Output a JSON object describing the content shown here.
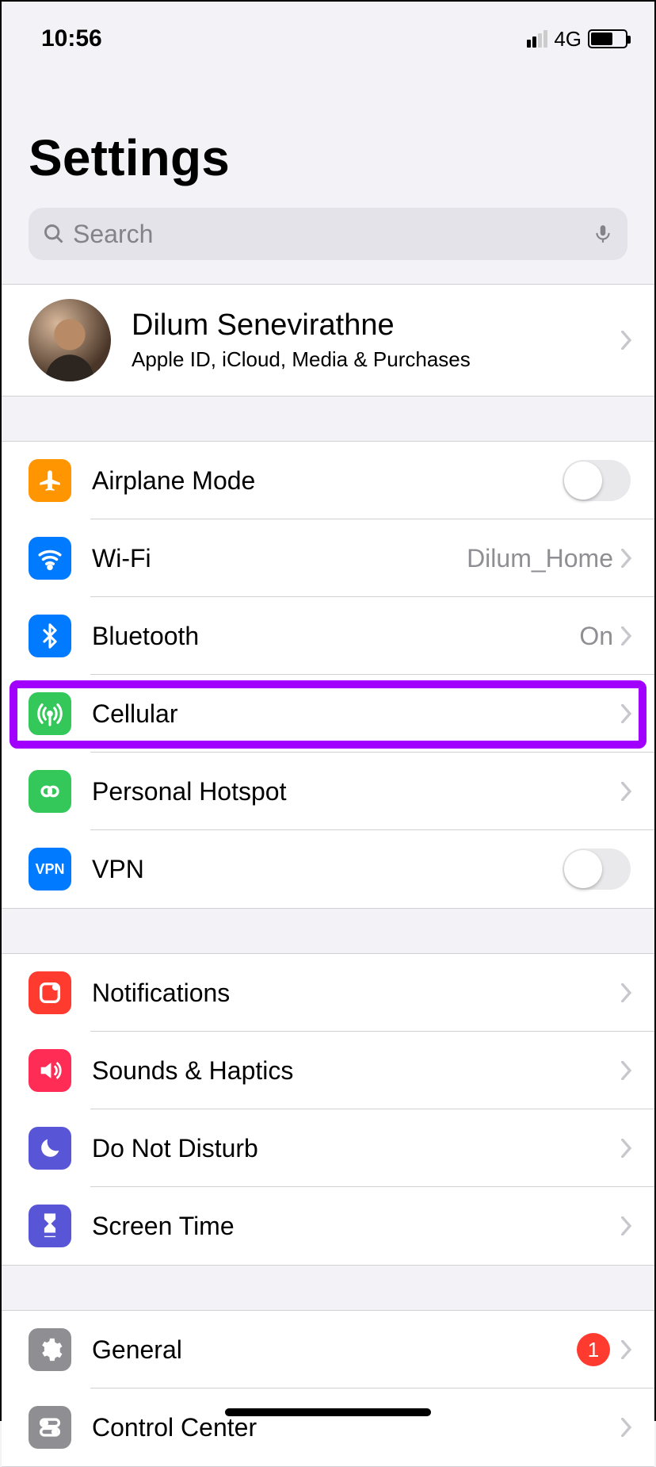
{
  "statusbar": {
    "time": "10:56",
    "network": "4G"
  },
  "header": {
    "title": "Settings"
  },
  "search": {
    "placeholder": "Search"
  },
  "profile": {
    "name": "Dilum Senevirathne",
    "subtitle": "Apple ID, iCloud, Media & Purchases"
  },
  "rows": {
    "airplane": {
      "label": "Airplane Mode"
    },
    "wifi": {
      "label": "Wi-Fi",
      "detail": "Dilum_Home"
    },
    "bluetooth": {
      "label": "Bluetooth",
      "detail": "On"
    },
    "cellular": {
      "label": "Cellular"
    },
    "hotspot": {
      "label": "Personal Hotspot"
    },
    "vpn": {
      "label": "VPN"
    },
    "notifications": {
      "label": "Notifications"
    },
    "sounds": {
      "label": "Sounds & Haptics"
    },
    "dnd": {
      "label": "Do Not Disturb"
    },
    "screentime": {
      "label": "Screen Time"
    },
    "general": {
      "label": "General",
      "badge": "1"
    },
    "controlcenter": {
      "label": "Control Center"
    }
  },
  "vpn_icon_text": "VPN"
}
